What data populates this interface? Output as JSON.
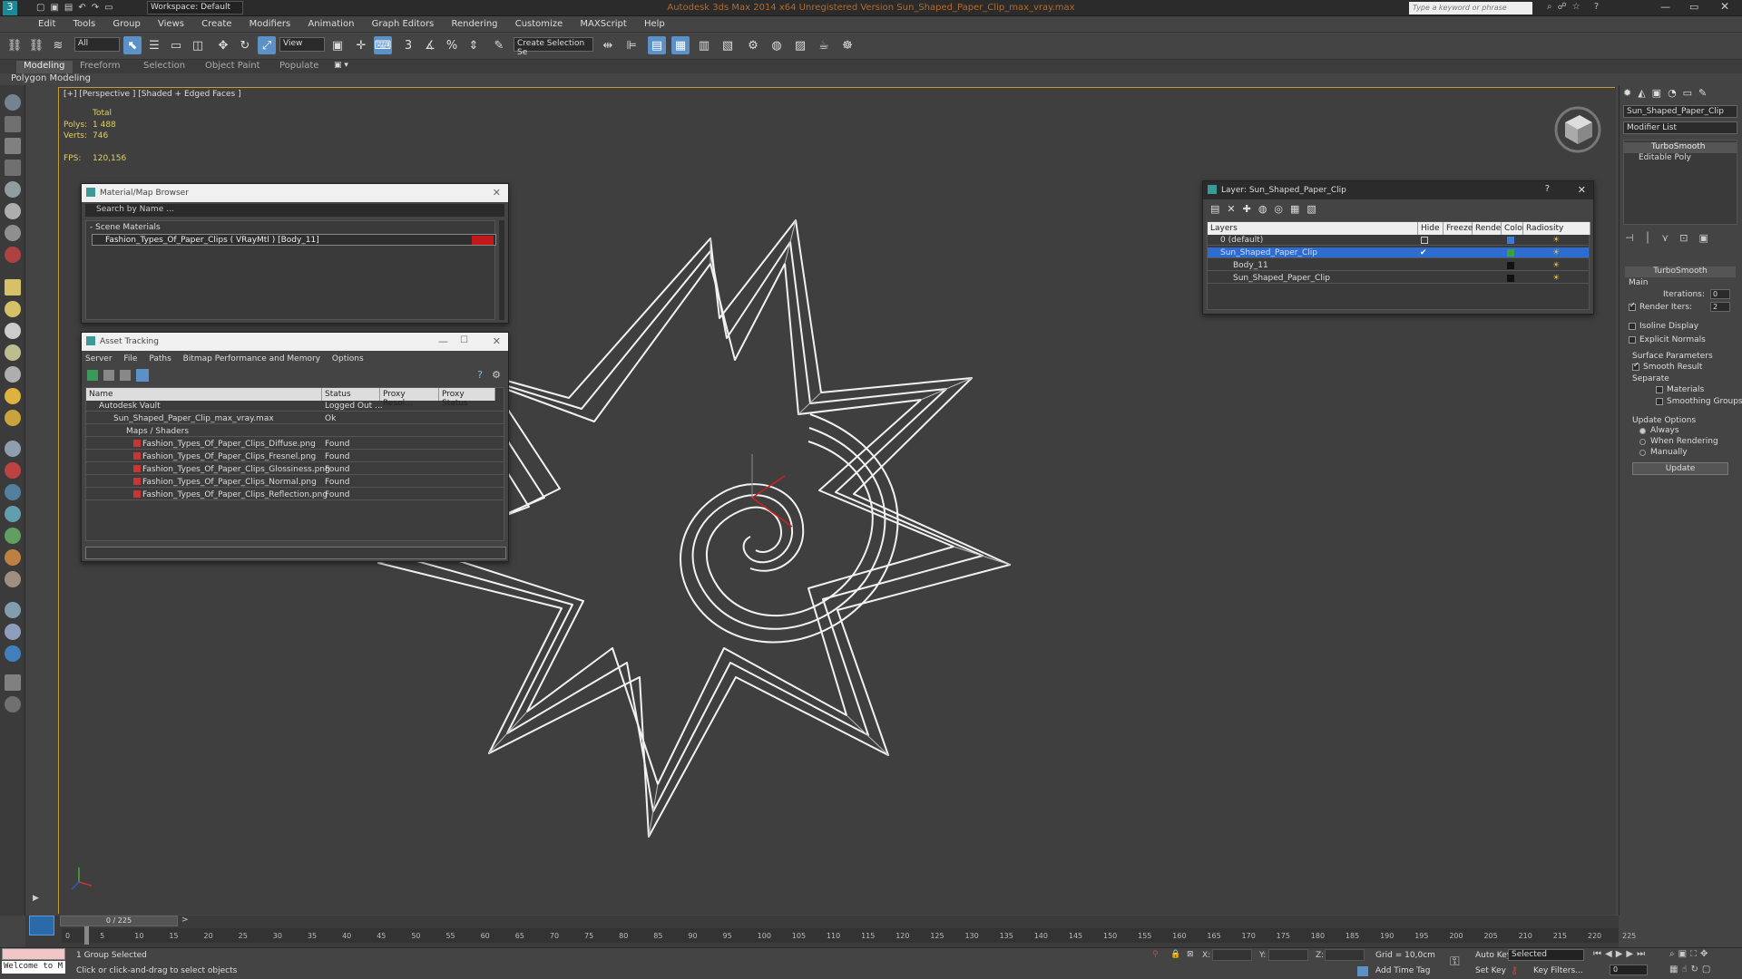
{
  "app": {
    "title": "Autodesk 3ds Max  2014 x64    Unregistered Version    Sun_Shaped_Paper_Clip_max_vray.max",
    "workspace": "Workspace: Default",
    "search_placeholder": "Type a keyword or phrase"
  },
  "menu": [
    "Edit",
    "Tools",
    "Group",
    "Views",
    "Create",
    "Modifiers",
    "Animation",
    "Graph Editors",
    "Rendering",
    "Customize",
    "MAXScript",
    "Help"
  ],
  "toolbar": {
    "filter": "All",
    "refcoord": "View",
    "named_selection": "Create Selection Se"
  },
  "ribbon": {
    "tabs": [
      "Modeling",
      "Freeform",
      "Selection",
      "Object Paint",
      "Populate"
    ],
    "sub": "Polygon Modeling"
  },
  "viewport": {
    "label": "[+] [Perspective ] [Shaded + Edged Faces ]",
    "stats": {
      "total": "Total",
      "polys_label": "Polys:",
      "polys": "1 488",
      "verts_label": "Verts:",
      "verts": "746",
      "fps_label": "FPS:",
      "fps": "120,156"
    }
  },
  "material_browser": {
    "title": "Material/Map Browser",
    "search": "Search by Name ...",
    "group": "- Scene Materials",
    "item": "Fashion_Types_Of_Paper_Clips ( VRayMtl ) [Body_11]"
  },
  "asset_tracking": {
    "title": "Asset Tracking",
    "menu": [
      "Server",
      "File",
      "Paths",
      "Bitmap Performance and Memory",
      "Options"
    ],
    "columns": [
      "Name",
      "Status",
      "Proxy Resol...",
      "Proxy Status"
    ],
    "rows": [
      {
        "name": "Autodesk Vault",
        "status": "Logged Out ..."
      },
      {
        "name": "Sun_Shaped_Paper_Clip_max_vray.max",
        "status": "Ok"
      },
      {
        "name": "Maps / Shaders",
        "status": ""
      },
      {
        "name": "Fashion_Types_Of_Paper_Clips_Diffuse.png",
        "status": "Found"
      },
      {
        "name": "Fashion_Types_Of_Paper_Clips_Fresnel.png",
        "status": "Found"
      },
      {
        "name": "Fashion_Types_Of_Paper_Clips_Glossiness.png",
        "status": "Found"
      },
      {
        "name": "Fashion_Types_Of_Paper_Clips_Normal.png",
        "status": "Found"
      },
      {
        "name": "Fashion_Types_Of_Paper_Clips_Reflection.png",
        "status": "Found"
      }
    ]
  },
  "layer_dialog": {
    "title": "Layer: Sun_Shaped_Paper_Clip",
    "help": "?",
    "columns": [
      "Layers",
      "Hide",
      "Freeze",
      "Render",
      "Color",
      "Radiosity"
    ],
    "rows": [
      {
        "name": "0 (default)",
        "color": "#3a7bd5"
      },
      {
        "name": "Sun_Shaped_Paper_Clip",
        "color": "#3aa040"
      },
      {
        "name": "Body_11",
        "color": "#111111"
      },
      {
        "name": "Sun_Shaped_Paper_Clip",
        "color": "#111111"
      }
    ]
  },
  "command_panel": {
    "object_name": "Sun_Shaped_Paper_Clip",
    "modifier_list": "Modifier List",
    "stack": [
      "TurboSmooth",
      "Editable Poly"
    ],
    "rollout": "TurboSmooth",
    "main": "Main",
    "iterations_label": "Iterations:",
    "iterations": "0",
    "render_iters_label": "Render Iters:",
    "render_iters": "2",
    "isoline": "Isoline Display",
    "explicit_normals": "Explicit Normals",
    "surface_params": "Surface Parameters",
    "smooth_result": "Smooth Result",
    "separate": "Separate",
    "materials": "Materials",
    "smoothing_groups": "Smoothing Groups",
    "update_options": "Update Options",
    "always": "Always",
    "when_rendering": "When Rendering",
    "manually": "Manually",
    "update_btn": "Update"
  },
  "timeline": {
    "frame": "0 / 225",
    "ticks": [
      "0",
      "5",
      "10",
      "15",
      "20",
      "25",
      "30",
      "35",
      "40",
      "45",
      "50",
      "55",
      "60",
      "65",
      "70",
      "75",
      "80",
      "85",
      "90",
      "95",
      "100",
      "105",
      "110",
      "115",
      "120",
      "125",
      "130",
      "135",
      "140",
      "145",
      "150",
      "155",
      "160",
      "165",
      "170",
      "175",
      "180",
      "185",
      "190",
      "195",
      "200",
      "205",
      "210",
      "215",
      "220",
      "225"
    ]
  },
  "status": {
    "maxscript": "Welcome to M",
    "selected": "1 Group Selected",
    "prompt": "Click or click-and-drag to select objects",
    "x_label": "X:",
    "y_label": "Y:",
    "z_label": "Z:",
    "grid": "Grid = 10,0cm",
    "add_time_tag": "Add Time Tag",
    "auto_key": "Auto Key",
    "selected_dd": "Selected",
    "set_key": "Set Key",
    "key_filters": "Key Filters...",
    "frame_field": "0"
  }
}
